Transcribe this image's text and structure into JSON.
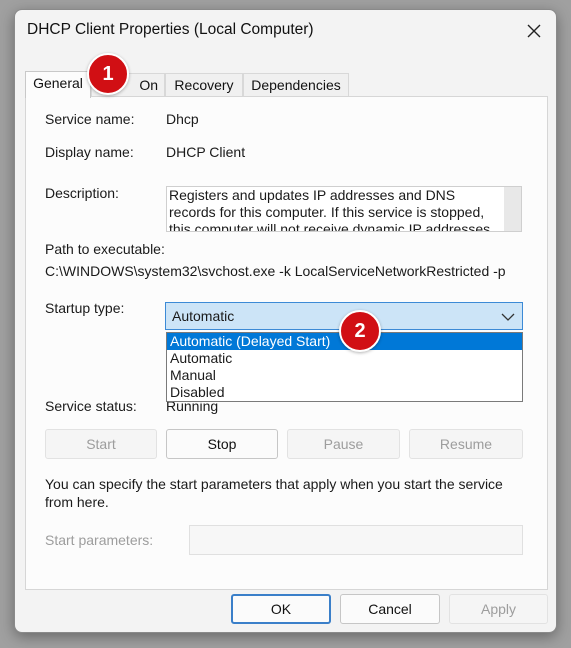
{
  "window": {
    "title": "DHCP Client Properties (Local Computer)"
  },
  "tabs": [
    {
      "label": "General",
      "active": true
    },
    {
      "label": "On"
    },
    {
      "label": "Recovery"
    },
    {
      "label": "Dependencies"
    }
  ],
  "general": {
    "service_name_label": "Service name:",
    "service_name_value": "Dhcp",
    "display_name_label": "Display name:",
    "display_name_value": "DHCP Client",
    "description_label": "Description:",
    "description_value": "Registers and updates IP addresses and DNS records for this computer. If this service is stopped, this computer will not receive dynamic IP addresses",
    "path_label": "Path to executable:",
    "path_value": "C:\\WINDOWS\\system32\\svchost.exe -k LocalServiceNetworkRestricted -p",
    "startup_type_label": "Startup type:",
    "startup_type_value": "Automatic",
    "startup_options": [
      "Automatic (Delayed Start)",
      "Automatic",
      "Manual",
      "Disabled"
    ],
    "highlighted_option": "Automatic (Delayed Start)",
    "service_status_label": "Service status:",
    "service_status_value": "Running",
    "buttons": {
      "start": "Start",
      "stop": "Stop",
      "pause": "Pause",
      "resume": "Resume"
    },
    "help_text": "You can specify the start parameters that apply when you start the service from here.",
    "start_parameters_label": "Start parameters:"
  },
  "footer": {
    "ok": "OK",
    "cancel": "Cancel",
    "apply": "Apply"
  },
  "annotations": [
    {
      "number": "1"
    },
    {
      "number": "2"
    }
  ],
  "colors": {
    "highlight": "#0078d7",
    "badge": "#d10f14",
    "select_bg": "#cce4f7"
  }
}
